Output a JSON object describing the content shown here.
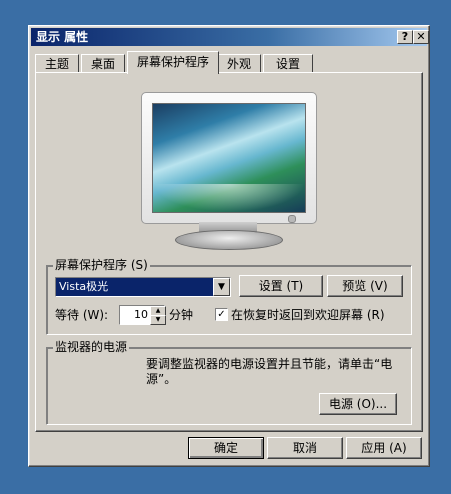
{
  "window": {
    "title": "显示 属性",
    "help_glyph": "?",
    "close_glyph": "✕"
  },
  "tabs": [
    "主题",
    "桌面",
    "屏幕保护程序",
    "外观",
    "设置"
  ],
  "screensaver": {
    "group_label": "屏幕保护程序 (S)",
    "selected": "Vista极光",
    "settings_button": "设置 (T)",
    "preview_button": "预览 (V)",
    "wait_label": "等待 (W):",
    "wait_value": "10",
    "minutes_label": "分钟",
    "resume_checked": true,
    "resume_check_glyph": "✓",
    "resume_label": "在恢复时返回到欢迎屏幕 (R)"
  },
  "power": {
    "group_label": "监视器的电源",
    "description_line1": "要调整监视器的电源设置并且节能，请单击“电",
    "description_line2": "源”。",
    "power_button": "电源 (O)..."
  },
  "footer": {
    "ok": "确定",
    "cancel": "取消",
    "apply": "应用 (A)"
  }
}
